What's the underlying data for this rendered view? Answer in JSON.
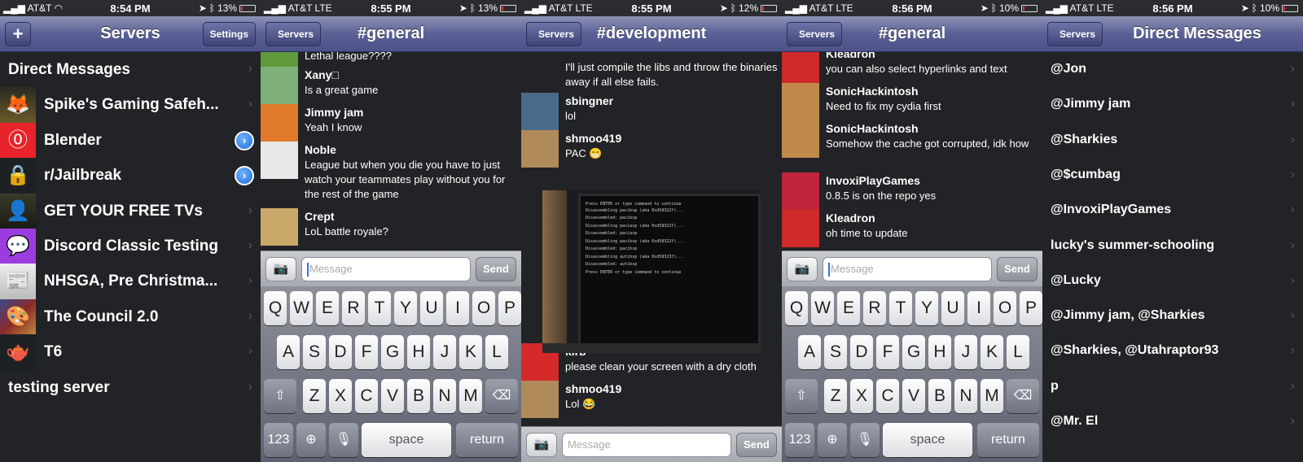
{
  "panels": [
    {
      "carrier": "AT&T",
      "network": "",
      "time": "8:54 PM",
      "battery": "13%",
      "title": "Servers",
      "settings_label": "Settings",
      "plus_label": "+"
    },
    {
      "carrier": "AT&T",
      "network": "LTE",
      "time": "8:55 PM",
      "battery": "13%",
      "title": "#general",
      "back_label": "Servers"
    },
    {
      "carrier": "AT&T",
      "network": "LTE",
      "time": "8:55 PM",
      "battery": "12%",
      "title": "#development",
      "back_label": "Servers"
    },
    {
      "carrier": "AT&T",
      "network": "LTE",
      "time": "8:56 PM",
      "battery": "10%",
      "title": "#general",
      "back_label": "Servers"
    },
    {
      "carrier": "AT&T",
      "network": "LTE",
      "time": "8:56 PM",
      "battery": "10%",
      "title": "Direct Messages",
      "back_label": "Servers"
    }
  ],
  "servers": [
    {
      "name": "Direct Messages",
      "icon": "none"
    },
    {
      "name": "Spike's Gaming Safeh...",
      "icon": "fox-hound-logo"
    },
    {
      "name": "Blender",
      "icon": "blender-logo",
      "disclosure": true
    },
    {
      "name": "r/Jailbreak",
      "icon": "padlock-icon",
      "disclosure": true
    },
    {
      "name": "GET YOUR FREE TVs",
      "icon": "photo-avatar"
    },
    {
      "name": "Discord Classic Testing",
      "icon": "discord-logo"
    },
    {
      "name": "NHSGA, Pre Christma...",
      "icon": "nhsga-logo"
    },
    {
      "name": "The Council 2.0",
      "icon": "comic-art"
    },
    {
      "name": "T6",
      "icon": "teapot-6-logo"
    },
    {
      "name": "testing server",
      "icon": "none"
    }
  ],
  "chat_general_1": [
    {
      "author": "",
      "text": "Lethal league????",
      "avatar_color": "#5e9a3a"
    },
    {
      "author": "Xany□",
      "text": "Is a great game",
      "avatar_color": "#7fb07a"
    },
    {
      "author": "Jimmy jam",
      "text": "Yeah I know",
      "avatar_color": "#e07a2a"
    },
    {
      "author": "Noble",
      "text": "League but when you die you have to just watch your teammates play without you for the rest of the game",
      "avatar_color": "#e8e8e8"
    },
    {
      "author": "Crept",
      "text": "LoL battle royale?",
      "avatar_color": "#c9a86a"
    }
  ],
  "chat_development": [
    {
      "author": "",
      "text": "I'll just compile the libs and throw the binaries away if all else fails.",
      "avatar_color": ""
    },
    {
      "author": "sbingner",
      "text": "lol",
      "avatar_color": "#4a6a8a"
    },
    {
      "author": "shmoo419",
      "text": "PAC 😁",
      "avatar_color": "#b08a5a"
    },
    {
      "author": "kirb",
      "text": "please clean your screen with a dry cloth",
      "avatar_color": "#d42a2a"
    },
    {
      "author": "shmoo419",
      "text": "Lol 😂",
      "avatar_color": "#b08a5a"
    }
  ],
  "terminal_lines": [
    "Press ENTER or type command to continue",
    "Disassembling pacibsp (aka 0xd58322f)...",
    "Disassembled: pacibsp",
    "Disassembling paciasp (aka 0xd58322f)...",
    "Disassembled: paciasp",
    "Disassembling pacibsp (aka 0xd58322f)...",
    "Disassembled: pacibsp",
    "Disassembling autibsp (aka 0xd58323f)...",
    "Disassembled: autibsp",
    "Press ENTER or type command to continue"
  ],
  "chat_general_2": [
    {
      "author": "Kleadron",
      "text": "you can also select hyperlinks and text",
      "avatar_color": "#d02a2a"
    },
    {
      "author": "SonicHackintosh",
      "text": "Need to fix my cydia first",
      "avatar_color": "#c08a4a"
    },
    {
      "author": "SonicHackintosh",
      "text": "Somehow the cache got corrupted, idk how",
      "avatar_color": "#c08a4a"
    },
    {
      "author": "InvoxiPlayGames",
      "text": "0.8.5 is on the repo yes",
      "avatar_color": "#c0243a"
    },
    {
      "author": "Kleadron",
      "text": "oh time to update",
      "avatar_color": "#d02a2a"
    }
  ],
  "composer": {
    "placeholder": "Message",
    "send_label": "Send"
  },
  "keyboard": {
    "row1": [
      "Q",
      "W",
      "E",
      "R",
      "T",
      "Y",
      "U",
      "I",
      "O",
      "P"
    ],
    "row2": [
      "A",
      "S",
      "D",
      "F",
      "G",
      "H",
      "J",
      "K",
      "L"
    ],
    "row3": [
      "Z",
      "X",
      "C",
      "V",
      "B",
      "N",
      "M"
    ],
    "numbers_label": "123",
    "space_label": "space",
    "return_label": "return"
  },
  "direct_messages": [
    "@Jon",
    "@Jimmy jam",
    "@Sharkies",
    "@$cumbag",
    "@InvoxiPlayGames",
    "lucky's summer-schooling",
    "@Lucky",
    "@Jimmy jam, @Sharkies",
    "@Sharkies, @Utahraptor93",
    "p",
    "@Mr. El"
  ],
  "colors": {
    "nav_blue": "#5a6095",
    "background": "#222326",
    "disclosure_blue": "#1f6fd6"
  }
}
